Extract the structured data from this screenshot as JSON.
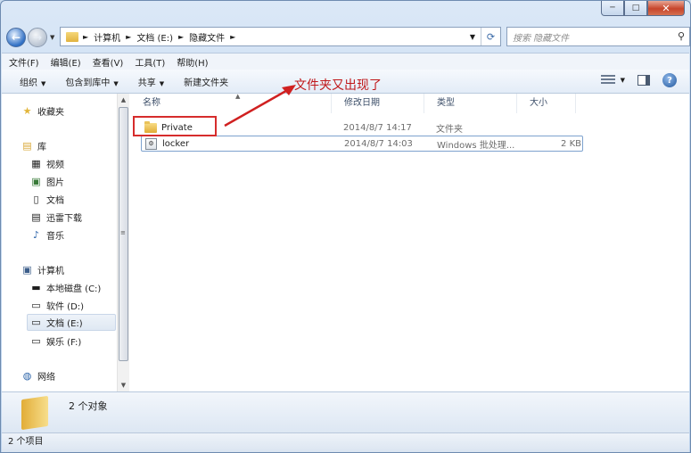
{
  "window": {
    "min_glyph": "─",
    "max_glyph": "□",
    "close_glyph": "✕"
  },
  "address": {
    "segments": [
      "计算机",
      "文档 (E:)",
      "隐藏文件"
    ],
    "separator": "►"
  },
  "search": {
    "placeholder": "搜索 隐藏文件"
  },
  "menu": [
    "文件(F)",
    "编辑(E)",
    "查看(V)",
    "工具(T)",
    "帮助(H)"
  ],
  "toolbar": {
    "organize": "组织",
    "include": "包含到库中",
    "share": "共享",
    "new_folder": "新建文件夹",
    "help": "?"
  },
  "nav": {
    "favorites": "收藏夹",
    "library": "库",
    "library_items": [
      "视频",
      "图片",
      "文档",
      "迅雷下载",
      "音乐"
    ],
    "computer": "计算机",
    "drives": [
      "本地磁盘 (C:)",
      "软件 (D:)",
      "文档 (E:)",
      "娱乐 (F:)"
    ],
    "network": "网络"
  },
  "columns": [
    "名称",
    "修改日期",
    "类型",
    "大小"
  ],
  "files": [
    {
      "name": "Private",
      "date": "2014/8/7 14:17",
      "type": "文件夹",
      "size": ""
    },
    {
      "name": "locker",
      "date": "2014/8/7 14:03",
      "type": "Windows 批处理...",
      "size": "2 KB"
    }
  ],
  "annotation": "文件夹又出现了",
  "details": {
    "count": "2 个对象"
  },
  "status": "2 个项目",
  "colors": {
    "annotation": "#c0181b",
    "selection_border": "#7da2ce"
  }
}
